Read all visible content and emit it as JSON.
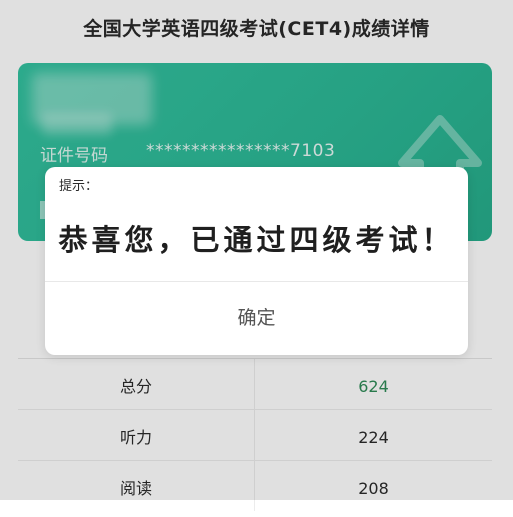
{
  "page": {
    "title": "全国大学英语四级考试(CET4)成绩详情"
  },
  "card": {
    "id_label": "证件号码",
    "id_value": "****************7103"
  },
  "scores": [
    {
      "label": "总分",
      "value": "624",
      "accent": true
    },
    {
      "label": "听力",
      "value": "224",
      "accent": false
    },
    {
      "label": "阅读",
      "value": "208",
      "accent": false
    }
  ],
  "dialog": {
    "title": "提示：",
    "message": "恭喜您，已通过四级考试！",
    "confirm_label": "确定"
  },
  "colors": {
    "card_green": "#2cb896",
    "total_score_green": "#2e8b57"
  }
}
